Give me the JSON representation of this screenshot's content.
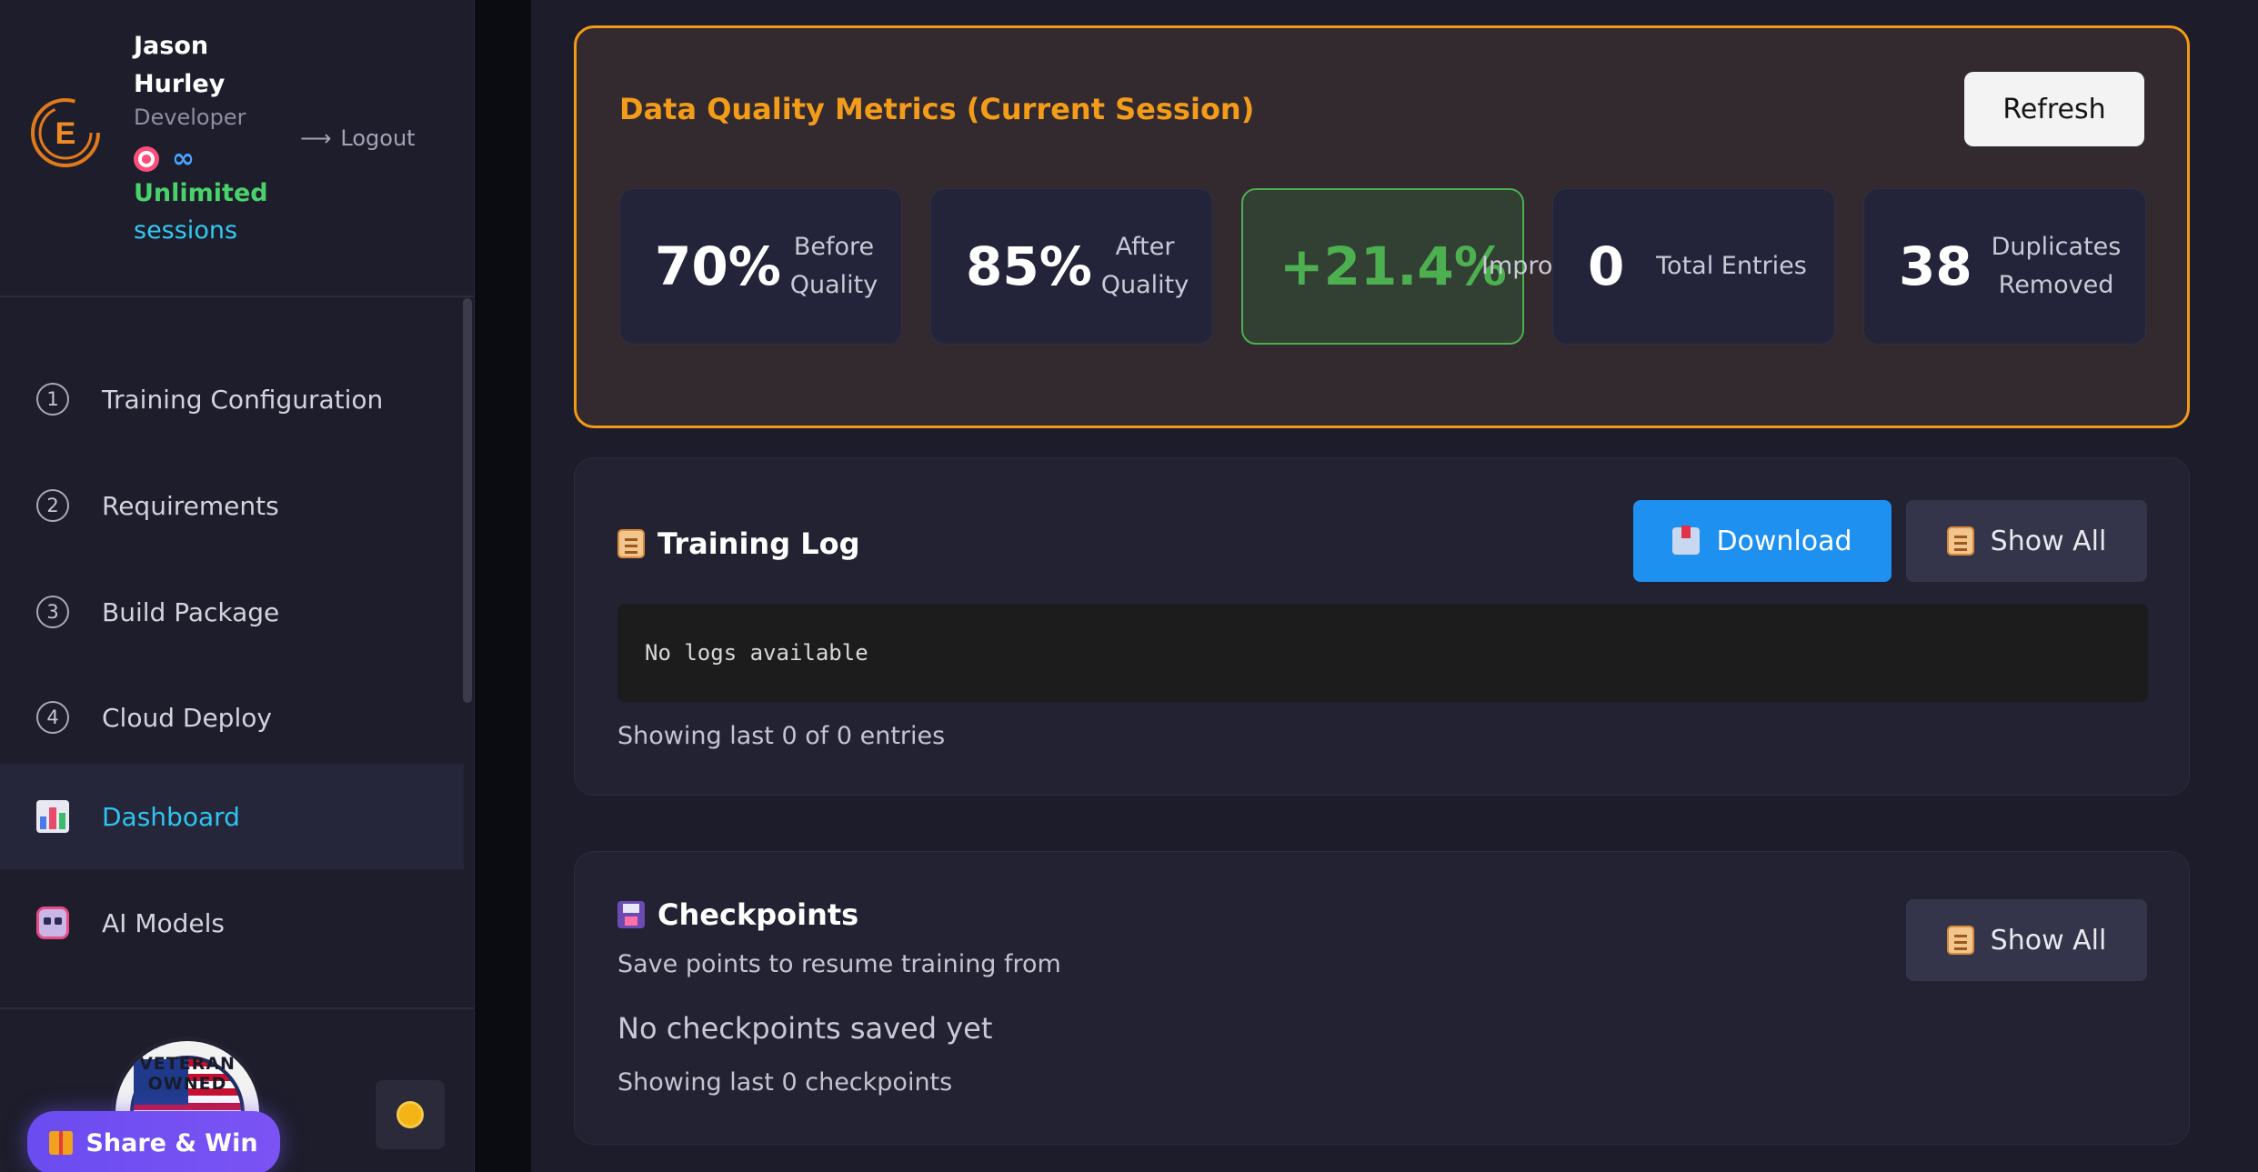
{
  "profile": {
    "name": "Jason Hurley",
    "role": "Developer",
    "logo_letter": "E",
    "infinity": "∞",
    "sessions_line1": "Unlimited",
    "sessions_line2": "sessions",
    "logout_arrow": "⟶",
    "logout_label": "Logout"
  },
  "nav": {
    "items": [
      {
        "num": "1",
        "label": "Training Configuration",
        "icon": "circled-1-icon"
      },
      {
        "num": "2",
        "label": "Requirements",
        "icon": "circled-2-icon"
      },
      {
        "num": "3",
        "label": "Build Package",
        "icon": "circled-3-icon"
      },
      {
        "num": "4",
        "label": "Cloud Deploy",
        "icon": "circled-4-icon"
      },
      {
        "label": "Dashboard",
        "icon": "bar-chart-icon",
        "active": true
      },
      {
        "label": "AI Models",
        "icon": "robot-icon"
      }
    ]
  },
  "footer": {
    "badge_text": "VETERAN OWNED",
    "share_label": "Share & Win"
  },
  "metrics": {
    "title": "Data Quality Metrics (Current Session)",
    "refresh_label": "Refresh",
    "cards": [
      {
        "value": "70%",
        "label_line1": "Before",
        "label_line2": "Quality"
      },
      {
        "value": "85%",
        "label_line1": "After",
        "label_line2": "Quality"
      },
      {
        "value": "+21.4%",
        "label_line1": "Improv",
        "highlight": true
      },
      {
        "value": "0",
        "label_line1": "Total Entries"
      },
      {
        "value": "38",
        "label_line1": "Duplicates",
        "label_line2": "Removed"
      }
    ]
  },
  "training_log": {
    "title": "Training Log",
    "download_label": "Download",
    "show_all_label": "Show All",
    "log_text": "No logs available",
    "footer_text": "Showing last 0 of 0 entries"
  },
  "checkpoints": {
    "title": "Checkpoints",
    "subtitle": "Save points to resume training from",
    "empty_text": "No checkpoints saved yet",
    "footer_text": "Showing last 0 checkpoints",
    "show_all_label": "Show All"
  },
  "colors": {
    "accent_orange": "#f29a18",
    "accent_cyan": "#2ec4f0",
    "success_green": "#4caf50",
    "primary_blue": "#1e90f0",
    "share_purple": "#6a4cf0"
  }
}
